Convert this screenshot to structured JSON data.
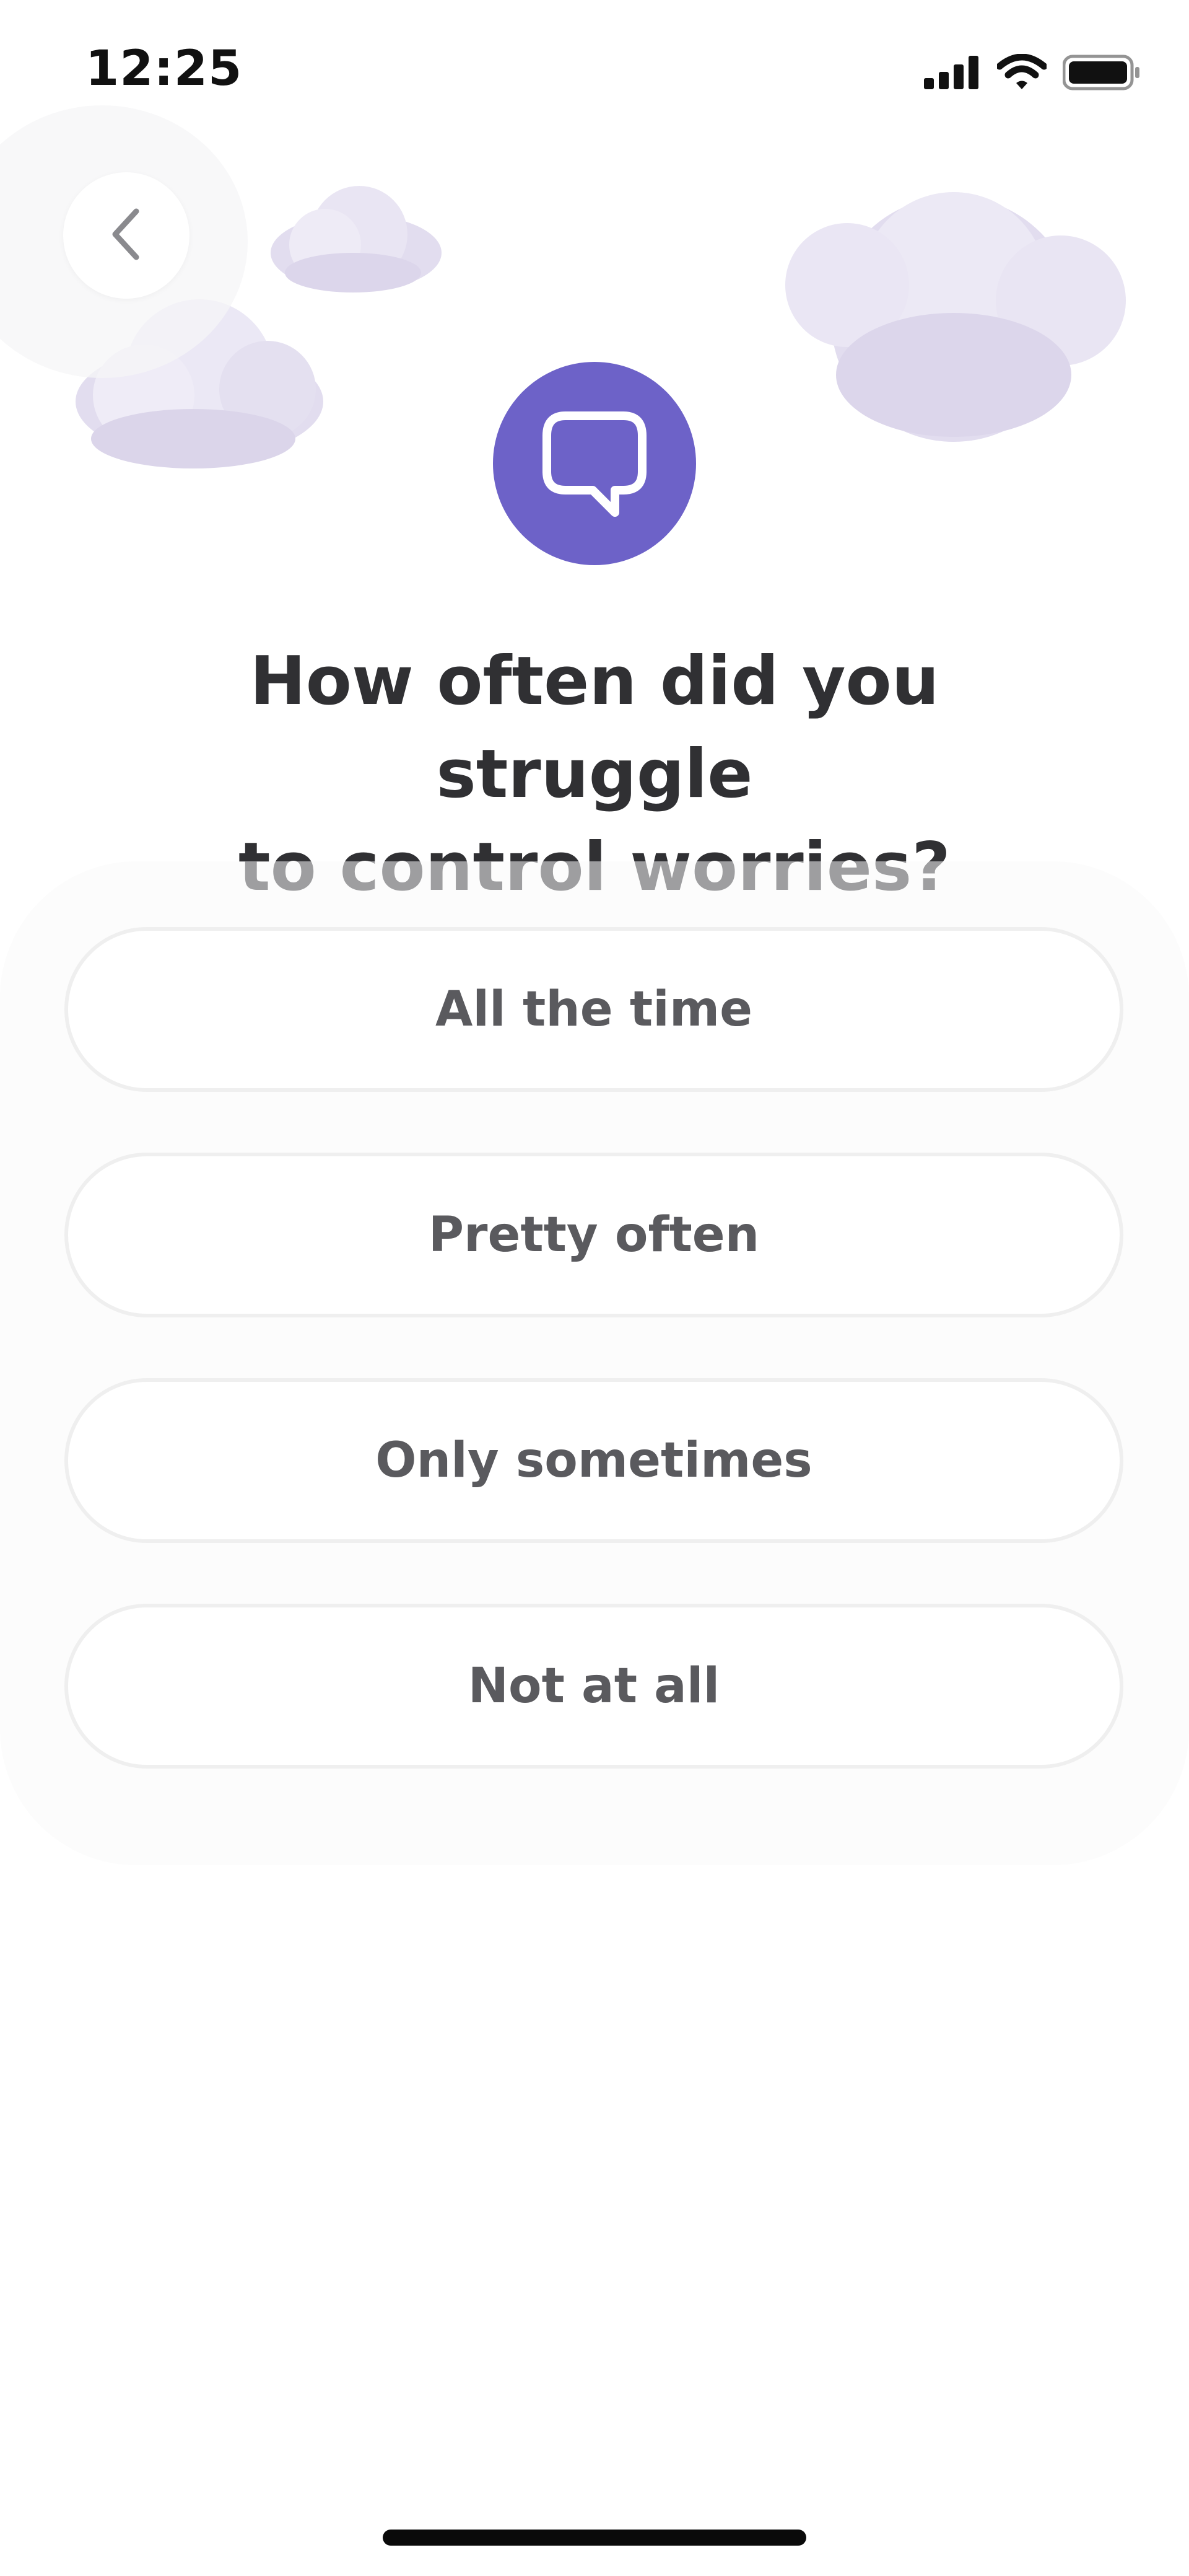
{
  "status_bar": {
    "time": "12:25",
    "icons": [
      "signal-icon",
      "wifi-icon",
      "battery-icon"
    ]
  },
  "navigation": {
    "back_icon": "chevron-left-icon"
  },
  "question": {
    "icon": "speech-bubble-icon",
    "icon_color": "#6d62c8",
    "title_line1": "How often did you struggle",
    "title_line2": "to control worries?"
  },
  "options": [
    {
      "label": "All the time"
    },
    {
      "label": "Pretty often"
    },
    {
      "label": "Only sometimes"
    },
    {
      "label": "Not at all"
    }
  ],
  "colors": {
    "accent": "#6d62c8",
    "cloud": "#e2ddef",
    "text": "#303033",
    "option_text": "#5a5a5e"
  }
}
